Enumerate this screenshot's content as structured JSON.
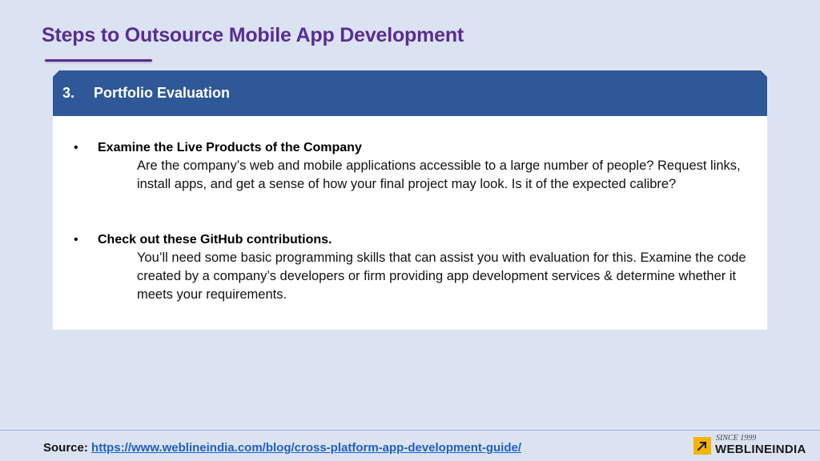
{
  "slide": {
    "title": "Steps to Outsource Mobile App Development"
  },
  "section": {
    "number": "3.",
    "title": "Portfolio Evaluation"
  },
  "bullets": [
    {
      "marker": "•",
      "heading": "Examine the Live Products of the Company",
      "body": "Are the company’s web and mobile applications accessible to a large number of people? Request links, install apps, and get a sense of how your final project may look. Is it of the expected calibre?"
    },
    {
      "marker": "•",
      "heading": "Check out these GitHub contributions.",
      "body": "You’ll need some basic programming skills that can assist you with evaluation for this. Examine the code created by a company’s developers or firm providing app development services & determine whether it meets your requirements."
    }
  ],
  "footer": {
    "source_label": "Source:",
    "source_url": "https://www.weblineindia.com/blog/cross-platform-app-development-guide/"
  },
  "logo": {
    "since": "SINCE 1999",
    "name": "WEBLINEINDIA"
  },
  "colors": {
    "title": "#5a2d91",
    "header_bar": "#2e5897",
    "background": "#dbe3f3",
    "link": "#1f5fbf",
    "logo_accent": "#f5b400"
  },
  "icons": {
    "logo_mark": "arrow-up-right-icon"
  }
}
